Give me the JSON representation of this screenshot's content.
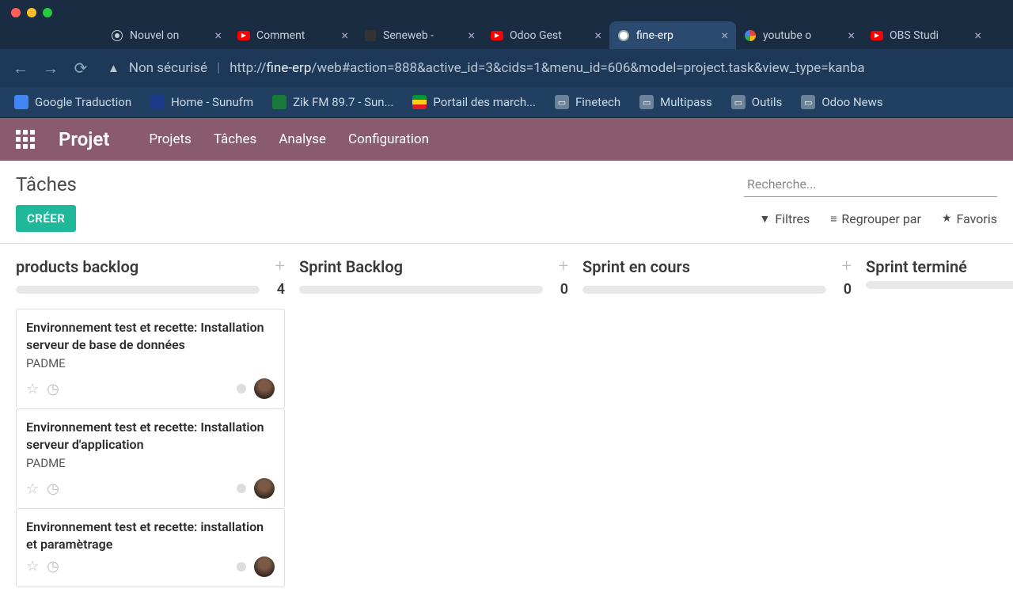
{
  "browser": {
    "tabs": [
      {
        "title": "Nouvel on",
        "icon": "chrome"
      },
      {
        "title": "Comment",
        "icon": "yt"
      },
      {
        "title": "Seneweb -",
        "icon": "sw"
      },
      {
        "title": "Odoo Gest",
        "icon": "yt"
      },
      {
        "title": "fine-erp",
        "icon": "fine",
        "active": true
      },
      {
        "title": "youtube o",
        "icon": "google"
      },
      {
        "title": "OBS Studi",
        "icon": "yt"
      }
    ],
    "security_label": "Non sécurisé",
    "url_host": "fine-erp",
    "url_path": "/web#action=888&active_id=3&cids=1&menu_id=606&model=project.task&view_type=kanba",
    "bookmarks": [
      {
        "label": "Google Traduction",
        "ico": "gt"
      },
      {
        "label": "Home - Sunufm",
        "ico": "su"
      },
      {
        "label": "Zik FM 89.7 - Sun...",
        "ico": "zk"
      },
      {
        "label": "Portail des march...",
        "ico": "sn"
      },
      {
        "label": "Finetech",
        "ico": "folder"
      },
      {
        "label": "Multipass",
        "ico": "folder"
      },
      {
        "label": "Outils",
        "ico": "folder"
      },
      {
        "label": "Odoo News",
        "ico": "folder"
      }
    ]
  },
  "app": {
    "title": "Projet",
    "menu": [
      "Projets",
      "Tâches",
      "Analyse",
      "Configuration"
    ],
    "breadcrumb": "Tâches",
    "create_label": "CRÉER",
    "search_placeholder": "Recherche...",
    "filters_label": "Filtres",
    "group_label": "Regrouper par",
    "fav_label": "Favoris"
  },
  "board": {
    "columns": [
      {
        "title": "products backlog",
        "count": "4",
        "cards": [
          {
            "title": "Environnement test et recette: Installation serveur de base de données",
            "sub": "PADME"
          },
          {
            "title": "Environnement test et recette: Installation serveur d'application",
            "sub": "PADME"
          },
          {
            "title": "Environnement test et recette: installation et paramètrage",
            "sub": ""
          }
        ]
      },
      {
        "title": "Sprint Backlog",
        "count": "0",
        "cards": []
      },
      {
        "title": "Sprint en cours",
        "count": "0",
        "cards": []
      },
      {
        "title": "Sprint terminé",
        "count": "",
        "cards": []
      }
    ]
  }
}
